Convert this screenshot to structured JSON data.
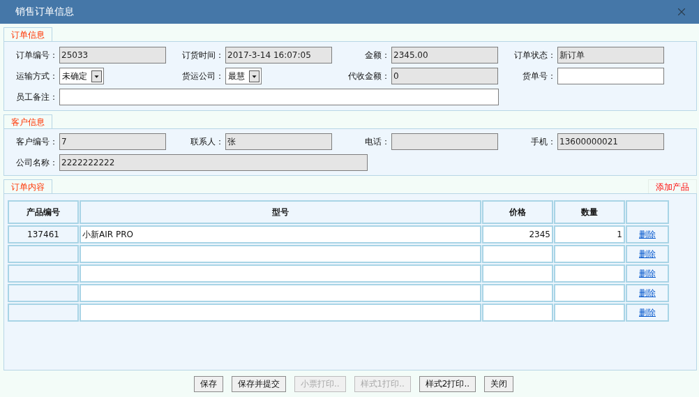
{
  "window": {
    "title": "销售订单信息"
  },
  "order_info": {
    "tab": "订单信息",
    "rows": [
      [
        {
          "label": "订单编号：",
          "value": "25033",
          "kind": "readonly"
        },
        {
          "label": "订货时间：",
          "value": "2017-3-14 16:07:05",
          "kind": "readonly"
        },
        {
          "label": "金额：",
          "value": "2345.00",
          "kind": "readonly"
        },
        {
          "label": "订单状态：",
          "value": "新订单",
          "kind": "readonly"
        }
      ],
      [
        {
          "label": "运输方式：",
          "value": "未确定",
          "kind": "select"
        },
        {
          "label": "货运公司：",
          "value": "最慧",
          "kind": "select"
        },
        {
          "label": "代收金额：",
          "value": "0",
          "kind": "readonly"
        },
        {
          "label": "货单号：",
          "kind": "text"
        }
      ],
      [
        {
          "label": "员工备注：",
          "kind": "note"
        }
      ]
    ]
  },
  "customer_info": {
    "tab": "客户信息",
    "rows": [
      [
        {
          "label": "客户编号：",
          "value": "7",
          "kind": "readonly"
        },
        {
          "label": "联系人：",
          "value": "张",
          "kind": "readonly"
        },
        {
          "label": "电话：",
          "kind": "readonly"
        },
        {
          "label": "手机：",
          "value": "13600000021",
          "kind": "readonly"
        }
      ],
      [
        {
          "label": "公司名称：",
          "value": "2222222222",
          "kind": "wide_readonly"
        }
      ]
    ]
  },
  "order_content": {
    "tab": "订单内容",
    "add_link": "添加产品",
    "columns": [
      "产品编号",
      "型号",
      "价格",
      "数量"
    ],
    "rows": [
      {
        "code": "137461",
        "model": "小新AIR PRO",
        "price": "2345",
        "qty": "1",
        "action": "删除"
      },
      {
        "action": "删除"
      },
      {
        "action": "删除"
      },
      {
        "action": "删除"
      },
      {
        "action": "删除"
      }
    ]
  },
  "buttons": [
    {
      "label": "保存",
      "disabled": false
    },
    {
      "label": "保存并提交",
      "disabled": false
    },
    {
      "label": "小票打印..",
      "disabled": true
    },
    {
      "label": "样式1打印..",
      "disabled": true
    },
    {
      "label": "样式2打印..",
      "disabled": false
    },
    {
      "label": "关闭",
      "disabled": false
    }
  ]
}
